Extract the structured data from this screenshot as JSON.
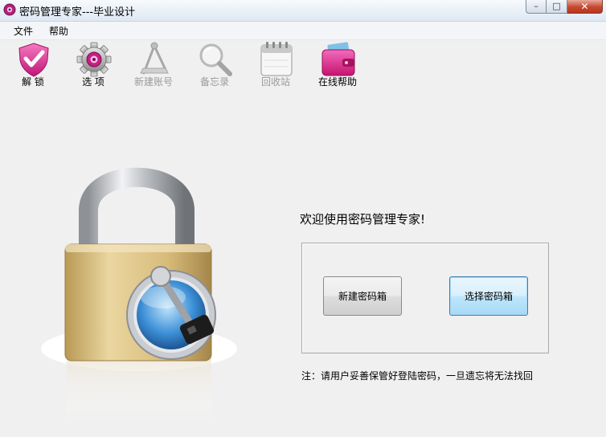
{
  "window": {
    "title": "密码管理专家---毕业设计",
    "controls": {
      "minimize": "–",
      "maximize": "□",
      "close": "✕"
    }
  },
  "menu": {
    "items": [
      "文件",
      "帮助"
    ]
  },
  "toolbar": {
    "items": [
      {
        "label": "解  锁",
        "icon": "shield-check-icon",
        "enabled": true
      },
      {
        "label": "选  项",
        "icon": "gear-icon",
        "enabled": true
      },
      {
        "label": "新建账号",
        "icon": "drafting-compass-icon",
        "enabled": false
      },
      {
        "label": "备忘录",
        "icon": "magnifier-icon",
        "enabled": false
      },
      {
        "label": "回收站",
        "icon": "calendar-icon",
        "enabled": false
      },
      {
        "label": "在线帮助",
        "icon": "pink-wallet-icon",
        "enabled": true
      }
    ]
  },
  "main": {
    "welcome": "欢迎使用密码管理专家!",
    "new_box_button": "新建密码箱",
    "select_box_button": "选择密码箱",
    "note": "注：请用户妥善保管好登陆密码，一旦遗忘将无法找回"
  },
  "colors": {
    "window_bg": "#f0f0f0",
    "focus_button_bg": "#bee6fd",
    "close_button_red": "#c6472e",
    "wallet_pink": "#e0218a"
  }
}
